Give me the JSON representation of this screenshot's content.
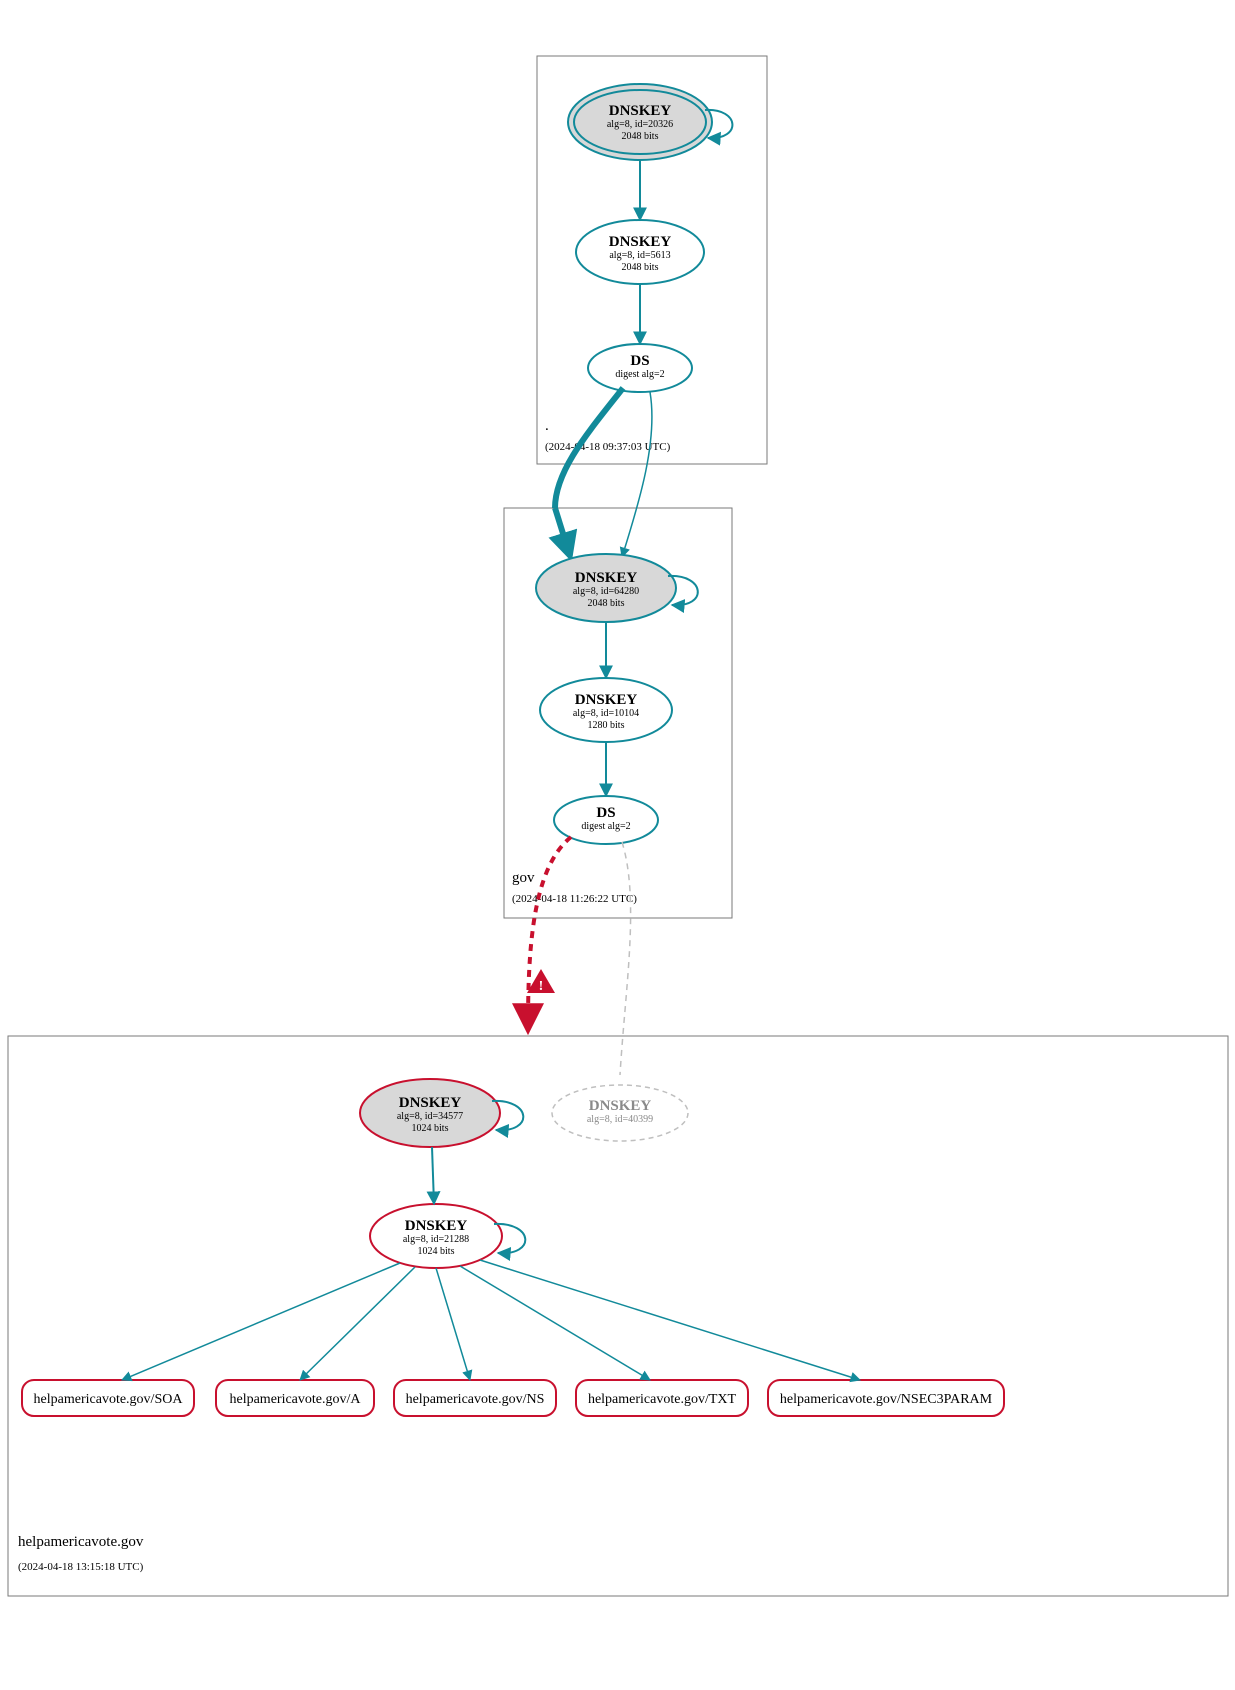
{
  "zones": {
    "root": {
      "label": ".",
      "timestamp": "(2024-04-18 09:37:03 UTC)",
      "ksk": {
        "title": "DNSKEY",
        "detail": "alg=8, id=20326",
        "bits": "2048 bits"
      },
      "zsk": {
        "title": "DNSKEY",
        "detail": "alg=8, id=5613",
        "bits": "2048 bits"
      },
      "ds": {
        "title": "DS",
        "detail": "digest alg=2"
      }
    },
    "gov": {
      "label": "gov",
      "timestamp": "(2024-04-18 11:26:22 UTC)",
      "ksk": {
        "title": "DNSKEY",
        "detail": "alg=8, id=64280",
        "bits": "2048 bits"
      },
      "zsk": {
        "title": "DNSKEY",
        "detail": "alg=8, id=10104",
        "bits": "1280 bits"
      },
      "ds": {
        "title": "DS",
        "detail": "digest alg=2"
      }
    },
    "hav": {
      "label": "helpamericavote.gov",
      "timestamp": "(2024-04-18 13:15:18 UTC)",
      "ksk": {
        "title": "DNSKEY",
        "detail": "alg=8, id=34577",
        "bits": "1024 bits"
      },
      "zsk": {
        "title": "DNSKEY",
        "detail": "alg=8, id=21288",
        "bits": "1024 bits"
      },
      "ghost": {
        "title": "DNSKEY",
        "detail": "alg=8, id=40399"
      }
    }
  },
  "rrsets": {
    "soa": "helpamericavote.gov/SOA",
    "a": "helpamericavote.gov/A",
    "ns": "helpamericavote.gov/NS",
    "txt": "helpamericavote.gov/TXT",
    "n3p": "helpamericavote.gov/NSEC3PARAM"
  },
  "colors": {
    "teal": "#128a9a",
    "red": "#c8102e",
    "grey": "#d8d8d8",
    "ghost": "#bfbfbf"
  }
}
